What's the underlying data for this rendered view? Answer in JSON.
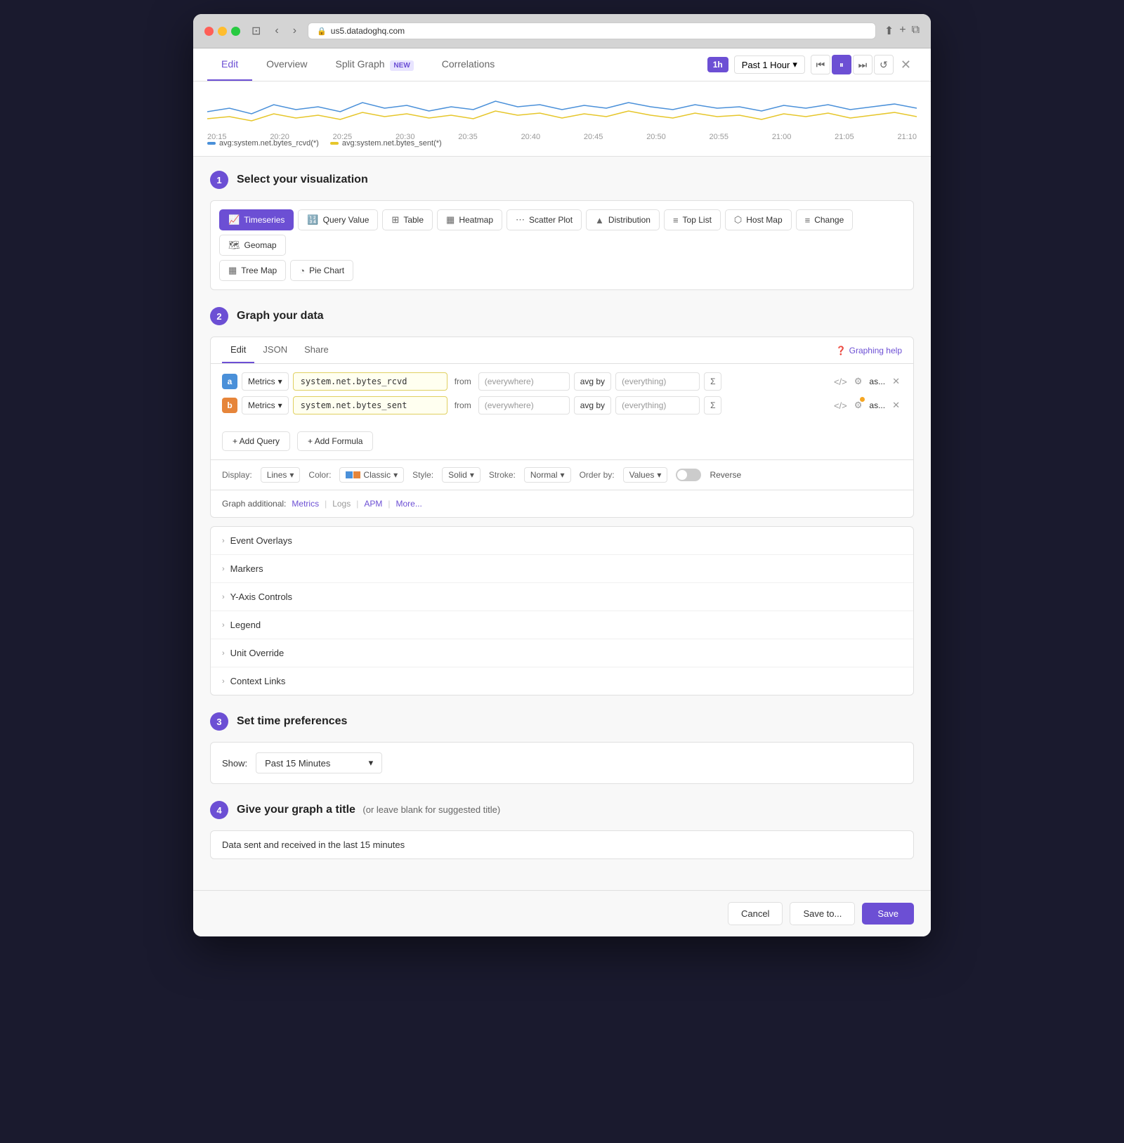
{
  "browser": {
    "url": "us5.datadoghq.com",
    "reload_icon": "⟳"
  },
  "header": {
    "tabs": [
      {
        "label": "Edit",
        "active": true
      },
      {
        "label": "Overview",
        "active": false
      },
      {
        "label": "Split Graph",
        "active": false,
        "badge": "NEW"
      },
      {
        "label": "Correlations",
        "active": false
      }
    ],
    "time_badge": "1h",
    "time_label": "Past 1 Hour",
    "close_label": "✕",
    "refresh_label": "↺"
  },
  "chart": {
    "time_labels": [
      "20:15",
      "20:20",
      "20:25",
      "20:30",
      "20:35",
      "20:40",
      "20:45",
      "20:50",
      "20:55",
      "21:00",
      "21:05",
      "21:10"
    ],
    "legend": [
      {
        "label": "avg:system.net.bytes_rcvd(*)",
        "color": "#4a90d9"
      },
      {
        "label": "avg:system.net.bytes_sent(*)",
        "color": "#e6c62a"
      }
    ]
  },
  "section1": {
    "step": "1",
    "title": "Select your visualization",
    "viz_options": [
      {
        "id": "timeseries",
        "label": "Timeseries",
        "icon": "📈",
        "active": true
      },
      {
        "id": "query-value",
        "label": "Query Value",
        "icon": "🔢",
        "active": false
      },
      {
        "id": "table",
        "label": "Table",
        "icon": "⊞",
        "active": false
      },
      {
        "id": "heatmap",
        "label": "Heatmap",
        "icon": "🌡",
        "active": false
      },
      {
        "id": "scatter",
        "label": "Scatter Plot",
        "icon": "⋯",
        "active": false
      },
      {
        "id": "distribution",
        "label": "Distribution",
        "icon": "▲",
        "active": false
      },
      {
        "id": "top-list",
        "label": "Top List",
        "icon": "≡",
        "active": false
      },
      {
        "id": "host-map",
        "label": "Host Map",
        "icon": "⬡",
        "active": false
      },
      {
        "id": "change",
        "label": "Change",
        "icon": "≡",
        "active": false
      },
      {
        "id": "geomap",
        "label": "Geomap",
        "icon": "🗺",
        "active": false
      },
      {
        "id": "tree-map",
        "label": "Tree Map",
        "icon": "▦",
        "active": false
      },
      {
        "id": "pie-chart",
        "label": "Pie Chart",
        "icon": "◔",
        "active": false
      }
    ]
  },
  "section2": {
    "step": "2",
    "title": "Graph your data",
    "query_tabs": [
      {
        "label": "Edit",
        "active": true
      },
      {
        "label": "JSON",
        "active": false
      },
      {
        "label": "Share",
        "active": false
      }
    ],
    "graphing_help_label": "Graphing help",
    "queries": [
      {
        "id": "a",
        "label_class": "label-a",
        "label": "a",
        "source": "Metrics",
        "metric": "system.net.bytes_rcvd",
        "from_label": "from",
        "filter": "(everywhere)",
        "avgby_label": "avg by",
        "groupby": "(everything)",
        "sigma": "Σ"
      },
      {
        "id": "b",
        "label_class": "label-b",
        "label": "b",
        "source": "Metrics",
        "metric": "system.net.bytes_sent",
        "from_label": "from",
        "filter": "(everywhere)",
        "avgby_label": "avg by",
        "groupby": "(everything)",
        "sigma": "Σ"
      }
    ],
    "add_query_label": "+ Add Query",
    "add_formula_label": "+ Add Formula",
    "display": {
      "label": "Display:",
      "type_label": "Lines",
      "color_label": "Color:",
      "color_scheme_label": "Classic",
      "style_label": "Style:",
      "style_value": "Solid",
      "stroke_label": "Stroke:",
      "stroke_value": "Normal",
      "order_label": "Order by:",
      "order_value": "Values",
      "reverse_label": "Reverse"
    },
    "graph_additional": {
      "label": "Graph additional:",
      "items": [
        {
          "label": "Metrics",
          "active": true
        },
        {
          "label": "Logs",
          "active": false
        },
        {
          "label": "APM",
          "active": true
        },
        {
          "label": "More...",
          "active": true
        }
      ]
    },
    "collapsibles": [
      {
        "label": "Event Overlays"
      },
      {
        "label": "Markers"
      },
      {
        "label": "Y-Axis Controls"
      },
      {
        "label": "Legend"
      },
      {
        "label": "Unit Override"
      },
      {
        "label": "Context Links"
      }
    ]
  },
  "section3": {
    "step": "3",
    "title": "Set time preferences",
    "show_label": "Show:",
    "time_value": "Past 15 Minutes"
  },
  "section4": {
    "step": "4",
    "title": "Give your graph a title",
    "subtitle": "(or leave blank for suggested title)",
    "title_value": "Data sent and received in the last 15 minutes"
  },
  "footer": {
    "cancel_label": "Cancel",
    "save_to_label": "Save to...",
    "save_label": "Save"
  }
}
